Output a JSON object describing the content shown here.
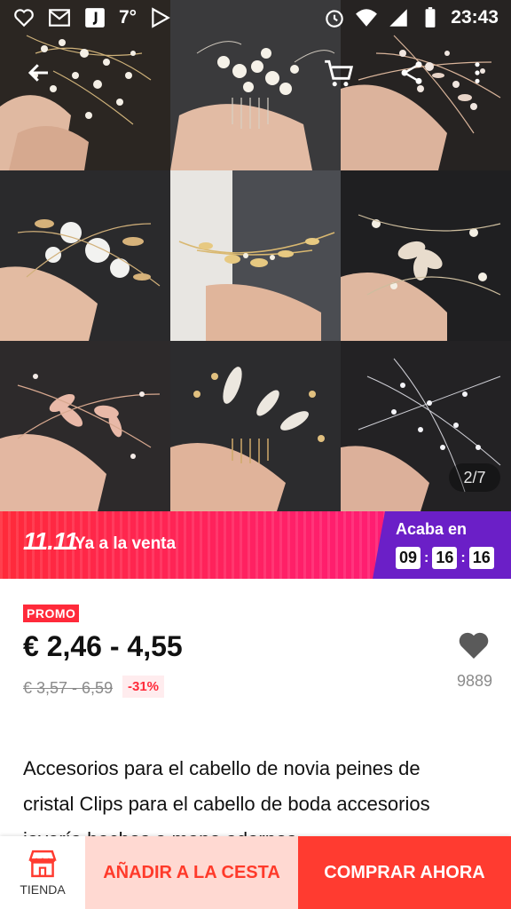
{
  "status_bar": {
    "temperature": "7°",
    "time": "23:43",
    "colors": {
      "text": "#ffffff"
    }
  },
  "gallery": {
    "counter": "2/7",
    "tiles": [
      {
        "name": "pearl-spray-comb",
        "tone": "gold-pearl"
      },
      {
        "name": "pearl-crystal-comb",
        "tone": "white-pearl"
      },
      {
        "name": "crystal-leaf-comb",
        "tone": "rose-gold"
      },
      {
        "name": "white-flower-leaf-comb",
        "tone": "gold-white"
      },
      {
        "name": "gold-vine-comb",
        "tone": "gold"
      },
      {
        "name": "pearl-flower-comb",
        "tone": "silver-pearl"
      },
      {
        "name": "rose-gold-flower-comb",
        "tone": "rose-gold"
      },
      {
        "name": "opal-leaf-comb",
        "tone": "gold-opal"
      },
      {
        "name": "crystal-spray-comb",
        "tone": "silver"
      }
    ]
  },
  "banner": {
    "brand": "11.11",
    "sale_text": "Ya a la venta",
    "ends_label": "Acaba en",
    "timer": {
      "hours": "09",
      "minutes": "16",
      "seconds": "16"
    },
    "colors": {
      "left": "#ff2a3a",
      "right": "#6b1fc7"
    }
  },
  "product": {
    "promo_tag": "PROMO",
    "price": "€ 2,46 - 4,55",
    "old_price": "€ 3,57 - 6,59",
    "discount": "-31%",
    "wishlist_count": "9889",
    "title": "Accesorios para el cabello de novia peines de cristal Clips para el cabello de boda accesorios joyería hechos a mano adornos"
  },
  "bottom_bar": {
    "store_label": "TIENDA",
    "add_to_cart": "AÑADIR A LA CESTA",
    "buy_now": "COMPRAR AHORA",
    "colors": {
      "add_bg": "#ffd9d2",
      "add_text": "#ff3a2a",
      "buy_bg": "#ff3b30"
    }
  },
  "icons": [
    "back-arrow-icon",
    "cart-icon",
    "share-icon",
    "more-icon",
    "heart-icon",
    "store-icon"
  ]
}
